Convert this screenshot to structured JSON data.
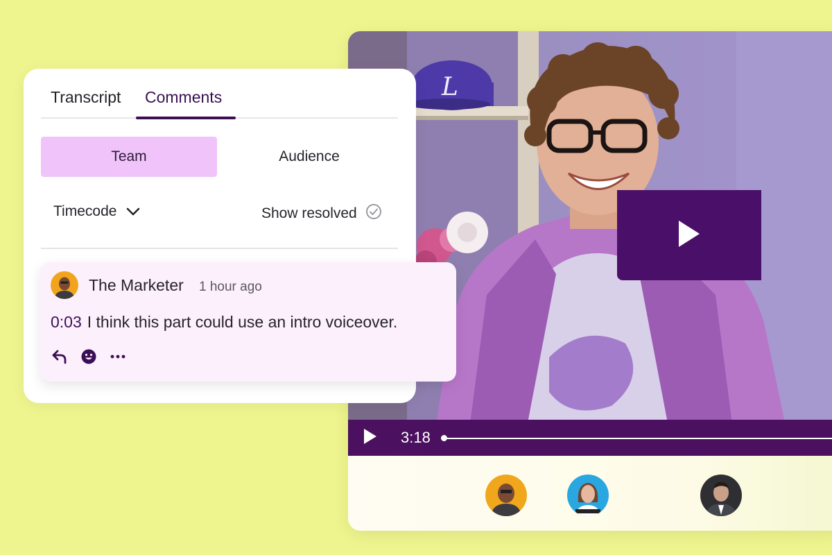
{
  "tabs": [
    {
      "label": "Transcript",
      "active": false
    },
    {
      "label": "Comments",
      "active": true
    }
  ],
  "segments": {
    "team": "Team",
    "audience": "Audience",
    "selected": "Team"
  },
  "filters": {
    "timecode": "Timecode",
    "show_resolved": "Show resolved"
  },
  "comment": {
    "author": "The Marketer",
    "time_ago": "1 hour ago",
    "timecode": "0:03",
    "text": "I think this part could use an intro voiceover.",
    "actions": [
      "reply-icon",
      "emoji-icon",
      "more-icon"
    ]
  },
  "video": {
    "current_time": "3:18",
    "play_icon": "play-icon",
    "participants": [
      "avatar-marketer",
      "avatar-woman",
      "avatar-man-suit"
    ]
  },
  "colors": {
    "background": "#eef58e",
    "accent_dark": "#4b105f",
    "team_tab": "#f0c4fb",
    "comment_bg": "#fdf0fd"
  }
}
